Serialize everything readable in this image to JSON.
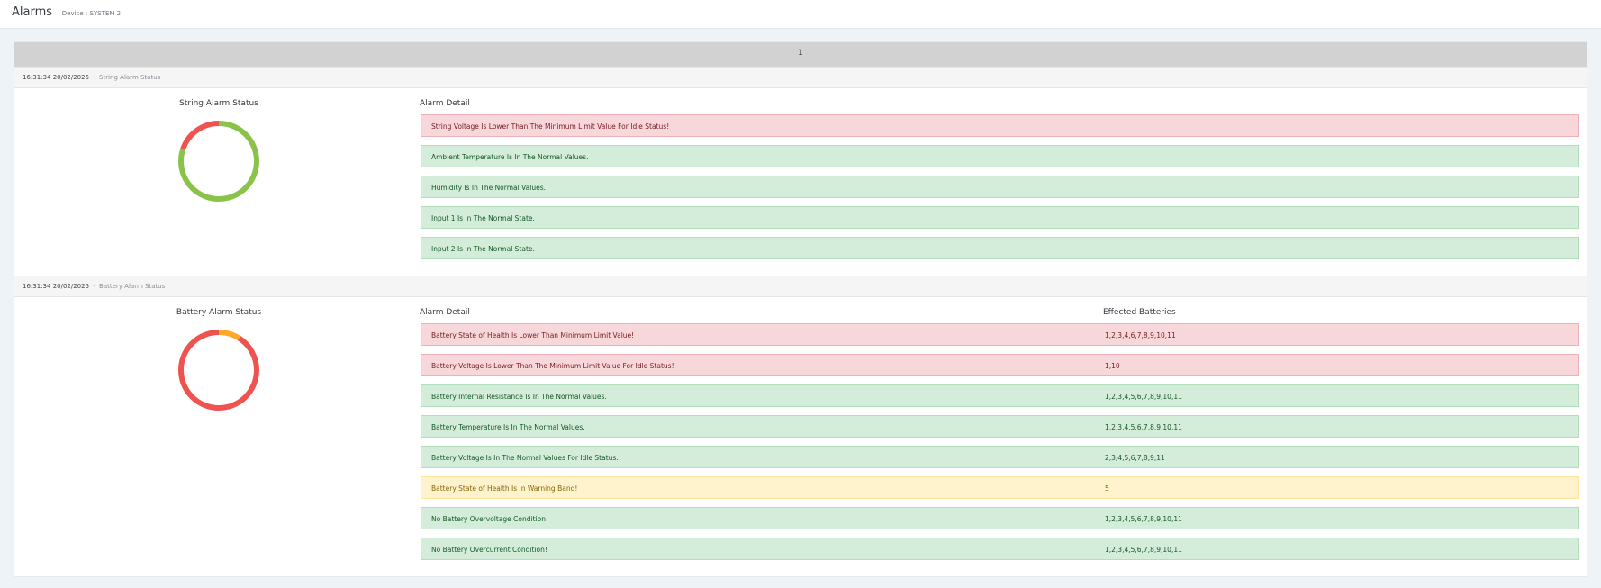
{
  "header": {
    "title": "Alarms",
    "device_label": "| Device : SYSTEM 2"
  },
  "pagination": {
    "current": "1"
  },
  "string_section": {
    "time": "16:31:34",
    "date": "20/02/2025",
    "separator": "-",
    "status": "String Alarm Status",
    "chart_title": "String Alarm Status",
    "column_header": "Alarm Detail",
    "donut": {
      "colors": {
        "ok": "#8bc34a",
        "error": "#ef5350",
        "warning": "#ffa726"
      },
      "ok_fraction": 0.8,
      "error_fraction": 0.2,
      "warning_fraction": 0
    },
    "alarms": [
      {
        "text": "String Voltage Is Lower Than The Minimum Limit Value For Idle Status!",
        "level": "danger"
      },
      {
        "text": "Ambient Temperature Is In The Normal Values.",
        "level": "success"
      },
      {
        "text": "Humidity Is In The Normal Values.",
        "level": "success"
      },
      {
        "text": "Input 1 Is In The Normal State.",
        "level": "success"
      },
      {
        "text": "Input 2 Is In The Normal State.",
        "level": "success"
      }
    ]
  },
  "battery_section": {
    "time": "16:31:34",
    "date": "20/02/2025",
    "separator": "-",
    "status": "Battery Alarm Status",
    "chart_title": "Battery Alarm Status",
    "column_header": "Alarm Detail",
    "batteries_header": "Effected Batteries",
    "donut": {
      "colors": {
        "error": "#ef5350",
        "warning": "#ffa726"
      },
      "error_fraction": 0.91,
      "warning_fraction": 0.09
    },
    "alarms": [
      {
        "text": "Battery State of Health Is Lower Than Minimum Limit Value!",
        "batteries": "1,2,3,4,6,7,8,9,10,11",
        "level": "danger"
      },
      {
        "text": "Battery Voltage Is Lower Than The Minimum Limit Value For Idle Status!",
        "batteries": "1,10",
        "level": "danger"
      },
      {
        "text": "Battery Internal Resistance Is In The Normal Values.",
        "batteries": "1,2,3,4,5,6,7,8,9,10,11",
        "level": "success"
      },
      {
        "text": "Battery Temperature Is In The Normal Values.",
        "batteries": "1,2,3,4,5,6,7,8,9,10,11",
        "level": "success"
      },
      {
        "text": "Battery Voltage Is In The Normal Values For Idle Status.",
        "batteries": "2,3,4,5,6,7,8,9,11",
        "level": "success"
      },
      {
        "text": "Battery State of Health Is In Warning Band!",
        "batteries": "5",
        "level": "warning"
      },
      {
        "text": "No Battery Overvoltage Condition!",
        "batteries": "1,2,3,4,5,6,7,8,9,10,11",
        "level": "success"
      },
      {
        "text": "No Battery Overcurrent Condition!",
        "batteries": "1,2,3,4,5,6,7,8,9,10,11",
        "level": "success"
      }
    ]
  }
}
